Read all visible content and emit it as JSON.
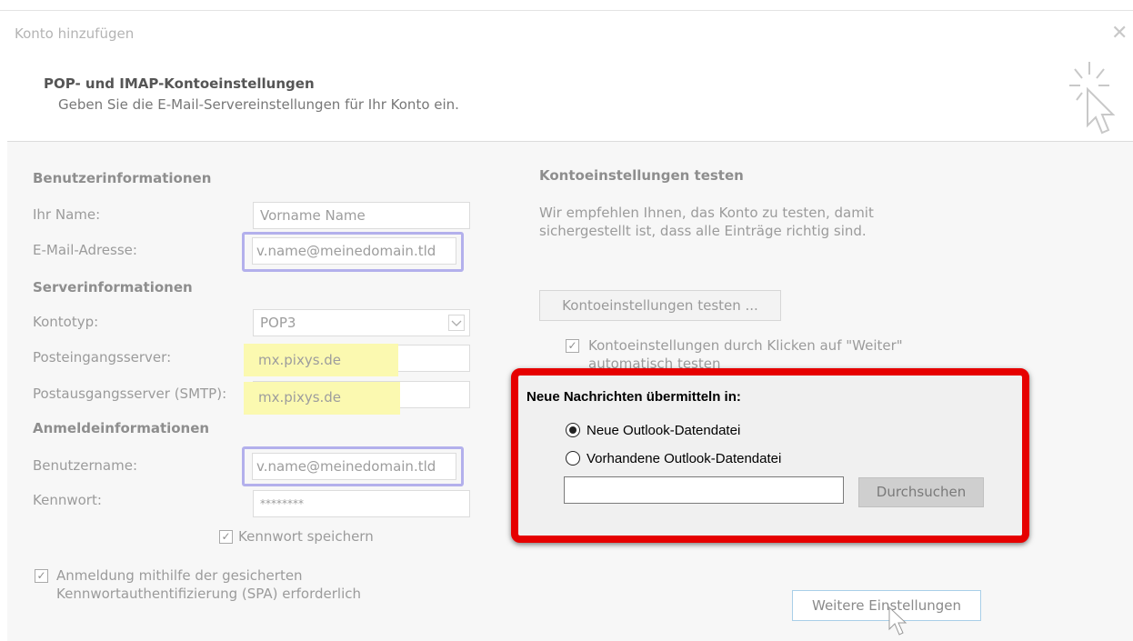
{
  "window": {
    "title": "Konto hinzufügen",
    "close_symbol": "✕"
  },
  "header": {
    "title": "POP- und IMAP-Kontoeinstellungen",
    "subtitle": "Geben Sie die E-Mail-Servereinstellungen für Ihr Konto ein."
  },
  "user_info": {
    "section": "Benutzerinformationen",
    "name_label": "Ihr Name:",
    "name_value": "Vorname Name",
    "email_label": "E-Mail-Adresse:",
    "email_value": "v.name@meinedomain.tld"
  },
  "server_info": {
    "section": "Serverinformationen",
    "account_type_label": "Kontotyp:",
    "account_type_value": "POP3",
    "incoming_label": "Posteingangsserver:",
    "incoming_value": "mx.pixys.de",
    "outgoing_label": "Postausgangsserver (SMTP):",
    "outgoing_value": "mx.pixys.de"
  },
  "login_info": {
    "section": "Anmeldeinformationen",
    "username_label": "Benutzername:",
    "username_value": "v.name@meinedomain.tld",
    "password_label": "Kennwort:",
    "password_value": "********",
    "save_password_label": "Kennwort speichern",
    "spa_label_line1": "Anmeldung mithilfe der gesicherten",
    "spa_label_line2": "Kennwortauthentifizierung (SPA) erforderlich"
  },
  "test": {
    "section": "Kontoeinstellungen testen",
    "desc_line1": "Wir empfehlen Ihnen, das Konto zu testen, damit",
    "desc_line2": "sichergestellt ist, dass alle Einträge richtig sind.",
    "test_button": "Kontoeinstellungen testen ...",
    "auto_test_line1": "Kontoeinstellungen durch Klicken auf \"Weiter\"",
    "auto_test_line2": "automatisch testen"
  },
  "deliver": {
    "title": "Neue Nachrichten übermitteln in:",
    "option_new": "Neue Outlook-Datendatei",
    "option_existing": "Vorhandene Outlook-Datendatei",
    "path_value": "",
    "browse_button": "Durchsuchen",
    "selected": "Neue Outlook-Datendatei"
  },
  "more_settings_button": "Weitere Einstellungen",
  "colors": {
    "highlight_red": "#e60000",
    "highlight_blue": "#b3b0ec",
    "highlight_yellow": "#fbf9b0"
  }
}
